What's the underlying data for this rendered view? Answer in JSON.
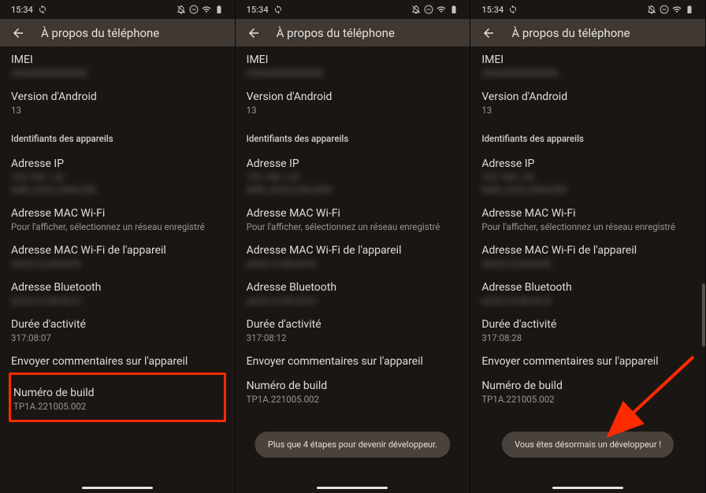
{
  "status": {
    "time": "15:34"
  },
  "header": {
    "title": "À propos du téléphone"
  },
  "items": {
    "imei_label": "IMEI",
    "imei_value": "359440000000000",
    "android_label": "Version d'Android",
    "android_value": "13",
    "section_ids": "Identifiants des appareils",
    "ip_label": "Adresse IP",
    "ip_value_a": "192.168.1.42",
    "ip_value_b": "fe80::a1b2:c3d4:e5f6",
    "mac_wifi_label": "Adresse MAC Wi-Fi",
    "mac_wifi_sub": "Pour l'afficher, sélectionnez un réseau enregistré",
    "mac_device_label": "Adresse MAC Wi-Fi de l'appareil",
    "mac_device_value": "a4:b2:c3:d4:e5:f6",
    "bt_label": "Adresse Bluetooth",
    "bt_value": "a4:b2:c3:d4:e5:a1",
    "uptime_label": "Durée d'activité",
    "feedback_label": "Envoyer commentaires sur l'appareil",
    "build_label": "Numéro de build",
    "build_value": "TP1A.221005.002"
  },
  "panels": [
    {
      "uptime": "317:08:07",
      "highlight": true,
      "toast": null,
      "scroll": false
    },
    {
      "uptime": "317:08:12",
      "highlight": false,
      "toast": "Plus que 4 étapes pour devenir développeur.",
      "scroll": false
    },
    {
      "uptime": "317:08:28",
      "highlight": false,
      "toast": "Vous êtes désormais un développeur !",
      "scroll": true
    }
  ],
  "toasts": {
    "p1": "Plus que 4 étapes pour devenir développeur.",
    "p2": "Vous êtes désormais un développeur !"
  }
}
